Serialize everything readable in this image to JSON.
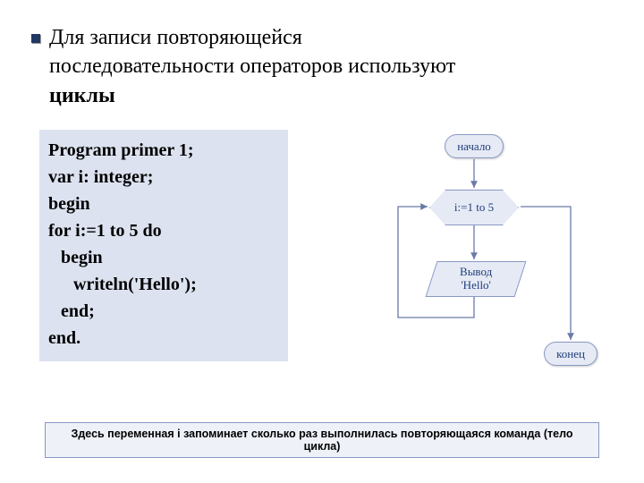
{
  "heading": {
    "line1": "Для  записи повторяющейся",
    "line2": "последовательности операторов используют",
    "line3_bold": "циклы"
  },
  "code": {
    "l1": "Program primer 1;",
    "l2": "var i: integer;",
    "l3": "begin",
    "l4": "for i:=1 to 5 do",
    "l5": "begin",
    "l6": "writeln('Hello');",
    "l7": "end;",
    "l8": "end."
  },
  "flow": {
    "start": "начало",
    "loop": "i:=1 to 5",
    "output": "Вывод\n'Hello'",
    "end": "конец"
  },
  "footer": "Здесь переменная i запоминает сколько раз выполнилась повторяющаяся команда (тело цикла)"
}
